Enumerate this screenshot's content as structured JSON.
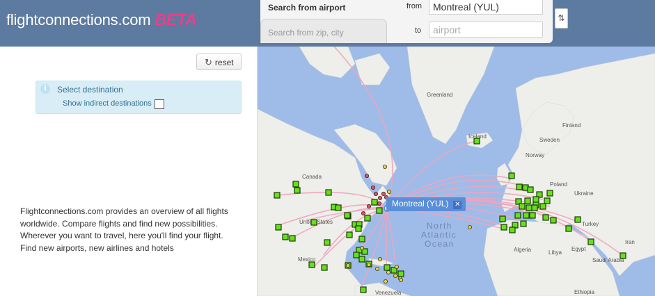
{
  "header": {
    "logo_text": "flightconnections.com",
    "logo_badge": "BETA",
    "search_tab_airport": "Search from airport",
    "search_tab_zip": "Search from zip, city",
    "from_label": "from",
    "from_value": "Montreal (YUL)",
    "to_label": "to",
    "to_placeholder": "airport",
    "swap_icon": "swap-vertical-icon"
  },
  "sidebar": {
    "reset_label": "reset",
    "select_destination": "Select destination",
    "show_indirect_label": "Show indirect destinations",
    "intro_lines": [
      "Flightconnections.com provides an overview of all flights",
      "worldwide. Compare flights and find new possibilities.",
      "Wherever you want to travel, here you'll find your flight.",
      "Find new airports, new airlines and hotels"
    ]
  },
  "map": {
    "origin_label": "Montreal (YUL)",
    "close_icon": "close-icon",
    "ocean_label_lines": [
      "North",
      "Atlantic",
      "Ocean"
    ],
    "place_labels": {
      "greenland": "Greenland",
      "iceland": "Iceland",
      "finland": "Finland",
      "sweden": "Sweden",
      "norway": "Norway",
      "poland": "Poland",
      "ukraine": "Ukraine",
      "turkey": "Turkey",
      "iran": "Iran",
      "canada": "Canada",
      "united_states": "United States",
      "mexico": "Mexico",
      "algeria": "Algeria",
      "libya": "Libya",
      "egypt": "Egypt",
      "saudi_arabia": "Saudi Arabia",
      "venezuela": "Venezuela",
      "ethiopia": "Ethiopia"
    },
    "colors": {
      "water": "#9fbce8",
      "land": "#eeeeea",
      "route": "#f0a3bc",
      "direct_airport": "#66e01a",
      "origin_area_airport": "#d35a6a",
      "indirect_airport": "#e8d04a"
    }
  }
}
